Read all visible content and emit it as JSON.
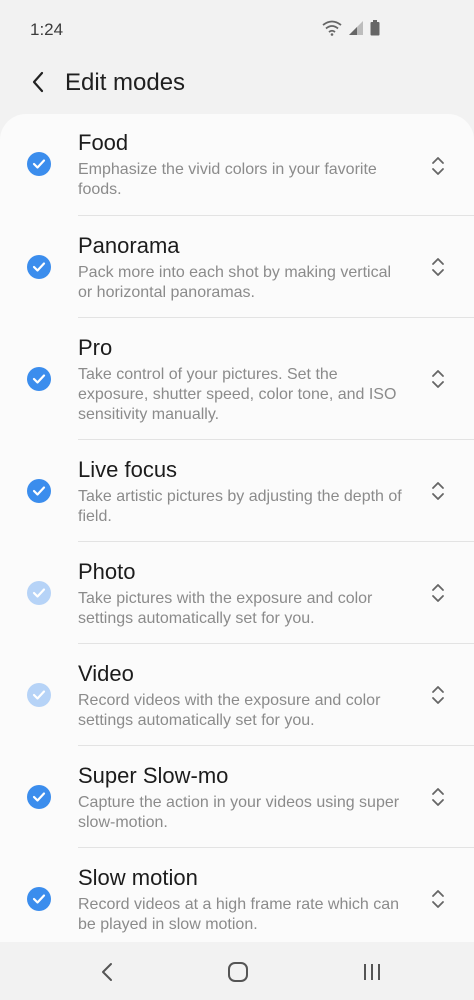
{
  "status_bar": {
    "time": "1:24",
    "icons": [
      "wifi-icon",
      "signal-icon",
      "battery-icon"
    ]
  },
  "header": {
    "back_icon": "back-arrow-icon",
    "title": "Edit modes"
  },
  "modes": [
    {
      "title": "Food",
      "description": "Emphasize the vivid colors in your favorite foods.",
      "checked": true,
      "enabled": true
    },
    {
      "title": "Panorama",
      "description": "Pack more into each shot by making vertical or horizontal panoramas.",
      "checked": true,
      "enabled": true
    },
    {
      "title": "Pro",
      "description": "Take control of your pictures. Set the exposure, shutter speed, color tone, and ISO sensitivity manually.",
      "checked": true,
      "enabled": true
    },
    {
      "title": "Live focus",
      "description": "Take artistic pictures by adjusting the depth of field.",
      "checked": true,
      "enabled": true
    },
    {
      "title": "Photo",
      "description": "Take pictures with the exposure and color settings automatically set for you.",
      "checked": true,
      "enabled": false
    },
    {
      "title": "Video",
      "description": "Record videos with the exposure and color settings automatically set for you.",
      "checked": true,
      "enabled": false
    },
    {
      "title": "Super Slow-mo",
      "description": "Capture the action in your videos using super slow-motion.",
      "checked": true,
      "enabled": true
    },
    {
      "title": "Slow motion",
      "description": "Record videos at a high frame rate which can be played in slow motion.",
      "checked": true,
      "enabled": true
    }
  ],
  "colors": {
    "accent": "#3b8ded",
    "accent_disabled": "#b6d3f7",
    "background": "#f2f2f2",
    "card": "#fbfbfb"
  },
  "nav_bar": {
    "icons": [
      "back-nav-icon",
      "home-nav-icon",
      "recents-nav-icon"
    ]
  }
}
